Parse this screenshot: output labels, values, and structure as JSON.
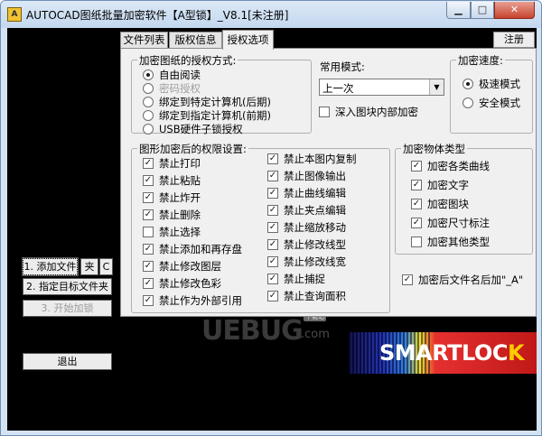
{
  "window": {
    "title": "AUTOCAD图纸批量加密软件【A型锁】_V8.1[未注册]",
    "app_icon_label": "A",
    "minimize_glyph": "▁",
    "maximize_glyph": "□",
    "close_glyph": "✕"
  },
  "tabs": [
    {
      "label": "文件列表",
      "active": false
    },
    {
      "label": "版权信息",
      "active": false
    },
    {
      "label": "授权选项",
      "active": true
    }
  ],
  "register_label": "注册",
  "auth_method": {
    "title": "加密图纸的授权方式:",
    "options": [
      {
        "label": "自由阅读",
        "selected": true,
        "enabled": true
      },
      {
        "label": "密码授权",
        "selected": false,
        "enabled": false
      },
      {
        "label": "绑定到特定计算机(后期)",
        "selected": false,
        "enabled": true
      },
      {
        "label": "绑定到指定计算机(前期)",
        "selected": false,
        "enabled": true
      },
      {
        "label": "USB硬件子锁授权",
        "selected": false,
        "enabled": true
      }
    ]
  },
  "common_mode": {
    "label": "常用模式:",
    "selected": "上一次",
    "arrow_glyph": "▼",
    "deep_encrypt_label": "深入图块内部加密",
    "deep_encrypt_checked": false
  },
  "speed": {
    "title": "加密速度:",
    "options": [
      {
        "label": "极速模式",
        "selected": true
      },
      {
        "label": "安全模式",
        "selected": false
      }
    ]
  },
  "permissions": {
    "title": "图形加密后的权限设置:",
    "left": [
      {
        "label": "禁止打印",
        "checked": true
      },
      {
        "label": "禁止粘贴",
        "checked": true
      },
      {
        "label": "禁止炸开",
        "checked": true
      },
      {
        "label": "禁止删除",
        "checked": true
      },
      {
        "label": "禁止选择",
        "checked": false
      },
      {
        "label": "禁止添加和再存盘",
        "checked": true
      },
      {
        "label": "禁止修改图层",
        "checked": true
      },
      {
        "label": "禁止修改色彩",
        "checked": true
      },
      {
        "label": "禁止作为外部引用",
        "checked": true
      }
    ],
    "right": [
      {
        "label": "禁止本图内复制",
        "checked": true
      },
      {
        "label": "禁止图像输出",
        "checked": true
      },
      {
        "label": "禁止曲线编辑",
        "checked": true
      },
      {
        "label": "禁止夹点编辑",
        "checked": true
      },
      {
        "label": "禁止缩放移动",
        "checked": true
      },
      {
        "label": "禁止修改线型",
        "checked": true
      },
      {
        "label": "禁止修改线宽",
        "checked": true
      },
      {
        "label": "禁止捕捉",
        "checked": true
      },
      {
        "label": "禁止查询面积",
        "checked": true
      }
    ]
  },
  "object_types": {
    "title": "加密物体类型",
    "options": [
      {
        "label": "加密各类曲线",
        "checked": true
      },
      {
        "label": "加密文字",
        "checked": true
      },
      {
        "label": "加密图块",
        "checked": true
      },
      {
        "label": "加密尺寸标注",
        "checked": true
      },
      {
        "label": "加密其他类型",
        "checked": false
      }
    ]
  },
  "suffix_option": {
    "label": "加密后文件名后加\"_A\"",
    "checked": true
  },
  "buttons": {
    "add_file": "1. 添加文件",
    "folder": "夹",
    "c": "C",
    "target_folder": "2. 指定目标文件夹",
    "start": "3. 开始加锁",
    "exit": "退出"
  },
  "watermark": {
    "brand": "UEBUG",
    "domain": ".com",
    "badge": "下载站"
  },
  "smartlock": {
    "prefix": "SMARTLOC",
    "suffix": "K"
  },
  "colors": {
    "accent_blue": "#1a2aa8",
    "smartlock_red": "#c01818",
    "panel_bg": "#f0f0f0"
  }
}
